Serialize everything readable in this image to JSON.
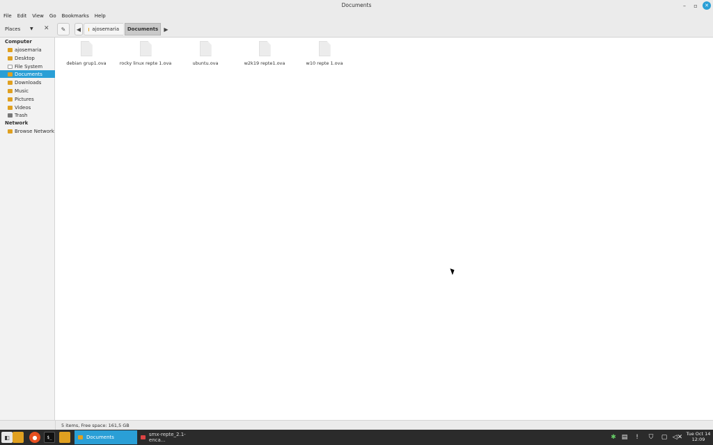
{
  "window": {
    "title": "Documents"
  },
  "menu": [
    "File",
    "Edit",
    "View",
    "Go",
    "Bookmarks",
    "Help"
  ],
  "toolbar": {
    "places_label": "Places",
    "breadcrumbs": [
      "ajosemaria",
      "Documents"
    ]
  },
  "sidebar": {
    "sections": [
      {
        "title": "Computer"
      },
      {
        "title": "Network"
      }
    ],
    "items": [
      {
        "label": "ajosemaria",
        "icon": "home-folder-icon"
      },
      {
        "label": "Desktop",
        "icon": "desktop-folder-icon"
      },
      {
        "label": "File System",
        "icon": "drive-icon"
      },
      {
        "label": "Documents",
        "icon": "documents-folder-icon",
        "selected": true
      },
      {
        "label": "Downloads",
        "icon": "downloads-folder-icon"
      },
      {
        "label": "Music",
        "icon": "music-folder-icon"
      },
      {
        "label": "Pictures",
        "icon": "pictures-folder-icon"
      },
      {
        "label": "Videos",
        "icon": "videos-folder-icon"
      },
      {
        "label": "Trash",
        "icon": "trash-icon"
      },
      {
        "label": "Browse Network",
        "icon": "network-icon"
      }
    ]
  },
  "files": [
    {
      "name": "debian grup1.ova"
    },
    {
      "name": "rocky linux repte 1.ova"
    },
    {
      "name": "ubuntu.ova"
    },
    {
      "name": "w2k19 repte1.ova"
    },
    {
      "name": "w10 repte 1.ova"
    }
  ],
  "status": "5 items, Free space: 161,5 GB",
  "taskbar": {
    "tasks": [
      "Documents",
      "smx-repte_2.1-enca..."
    ],
    "clock_day": "Tue Oct 14",
    "clock_time": "12:09"
  },
  "colors": {
    "accent": "#2a9fd6",
    "folder": "#e0a020",
    "taskbar": "#2b2b2b"
  }
}
